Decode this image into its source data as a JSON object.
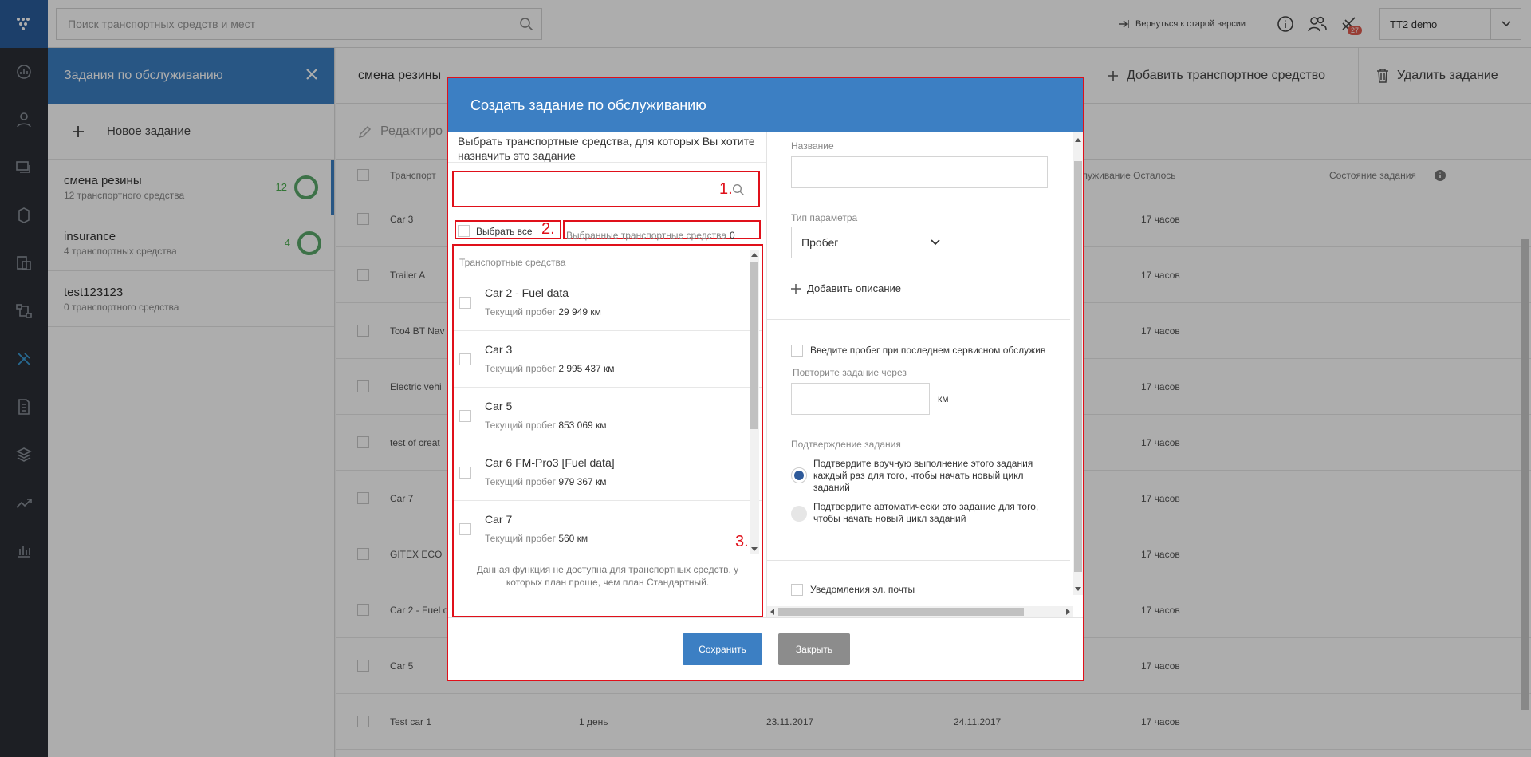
{
  "topbar": {
    "search_placeholder": "Поиск транспортных средств и мест",
    "back_to_old": "Вернуться к старой версии",
    "notification_count": "27",
    "account": "TT2 demo"
  },
  "left_panel": {
    "title": "Задания по обслуживанию",
    "new_task": "Новое задание",
    "tasks": [
      {
        "name": "смена резины",
        "sub": "12 транспортного средства",
        "count": "12"
      },
      {
        "name": "insurance",
        "sub": "4 транспортных средства",
        "count": "4"
      },
      {
        "name": "test123123",
        "sub": "0 транспортного средства",
        "count": ""
      }
    ]
  },
  "main": {
    "task_title": "смена резины",
    "add_vehicle": "Добавить транспортное средство",
    "delete_task": "Удалить задание",
    "edit": "Редактиро",
    "col_vehicle": "Транспорт",
    "col_remaining": "служивание Осталось",
    "col_state": "Состояние задания",
    "rows": [
      {
        "name": "Car 3",
        "c1": "",
        "c2": "",
        "c3": "",
        "rem": "17 часов"
      },
      {
        "name": "Trailer A",
        "c1": "",
        "c2": "",
        "c3": "",
        "rem": "17 часов"
      },
      {
        "name": "Tco4 BT Nav",
        "c1": "",
        "c2": "",
        "c3": "",
        "rem": "17 часов"
      },
      {
        "name": "Electric vehi",
        "c1": "",
        "c2": "",
        "c3": "",
        "rem": "17 часов"
      },
      {
        "name": "test of creat",
        "c1": "",
        "c2": "",
        "c3": "",
        "rem": "17 часов"
      },
      {
        "name": "Car 7",
        "c1": "",
        "c2": "",
        "c3": "",
        "rem": "17 часов"
      },
      {
        "name": "GITEX ECO",
        "c1": "",
        "c2": "",
        "c3": "",
        "rem": "17 часов"
      },
      {
        "name": "Car 2 - Fuel d",
        "c1": "",
        "c2": "",
        "c3": "",
        "rem": "17 часов"
      },
      {
        "name": "Car 5",
        "c1": "",
        "c2": "",
        "c3": "",
        "rem": "17 часов"
      },
      {
        "name": "Test car 1",
        "c1": "1 день",
        "c2": "23.11.2017",
        "c3": "24.11.2017",
        "rem": "17 часов"
      }
    ]
  },
  "modal": {
    "title": "Создать задание по обслуживанию",
    "select_desc": "Выбрать транспортные средства, для которых Вы хотите назначить это задание",
    "select_all": "Выбрать все",
    "selected_label": "Выбранные транспортные средства",
    "selected_count": "0",
    "list_header": "Транспортные средства",
    "mileage_label": "Текущий пробег",
    "vehicles": [
      {
        "name": "Car 2 - Fuel data",
        "mileage": "29 949 км"
      },
      {
        "name": "Car 3",
        "mileage": "2 995 437 км"
      },
      {
        "name": "Car 5",
        "mileage": "853 069 км"
      },
      {
        "name": "Car 6 FM-Pro3 [Fuel data]",
        "mileage": "979 367 км"
      },
      {
        "name": "Car 7",
        "mileage": "560 км"
      }
    ],
    "note": "Данная функция не доступна для транспортных средств, у которых план проще, чем план Стандартный.",
    "annotations": [
      "1.",
      "2.",
      "3."
    ],
    "name_label": "Название",
    "param_type_label": "Тип параметра",
    "param_type_value": "Пробег",
    "add_description": "Добавить описание",
    "last_service_mileage": "Введите пробег при последнем сервисном обслужив",
    "repeat_label": "Повторите задание через",
    "repeat_unit": "км",
    "confirm_label": "Подтверждение задания",
    "confirm_manual": "Подтвердите вручную выполнение этого задания каждый раз для того, чтобы начать новый цикл заданий",
    "confirm_auto": "Подтвердите автоматически это задание для того, чтобы начать новый цикл заданий",
    "email_notifications": "Уведомления эл. почты",
    "save": "Сохранить",
    "close": "Закрыть"
  },
  "colors": {
    "accent": "#3c7fc3",
    "annotation": "#e0101a",
    "rail": "#2b2f36"
  }
}
